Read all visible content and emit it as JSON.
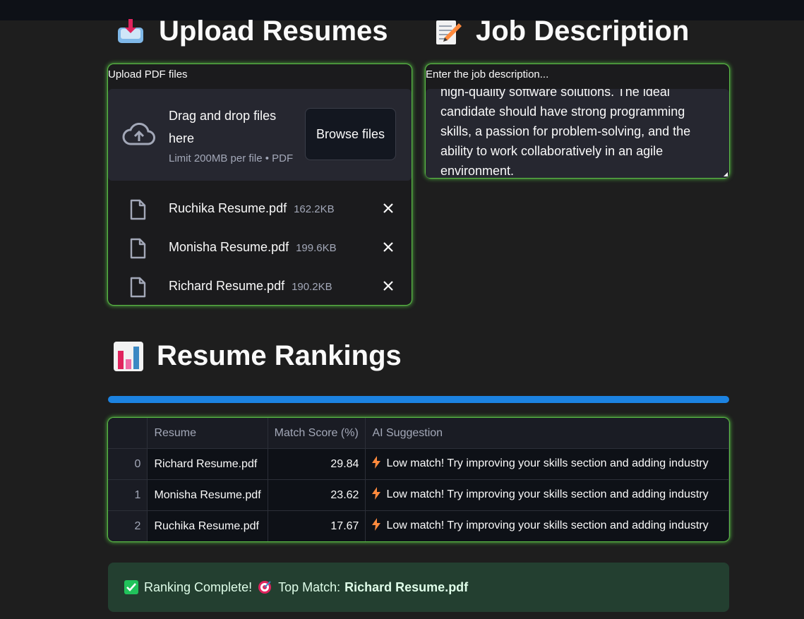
{
  "upload": {
    "heading": "Upload Resumes",
    "heading_icon": "inbox-tray-icon",
    "label": "Upload PDF files",
    "dropzone_title": "Drag and drop files here",
    "dropzone_limit": "Limit 200MB per file • PDF",
    "browse_label": "Browse files",
    "files": [
      {
        "name": "Ruchika Resume.pdf",
        "size": "162.2KB"
      },
      {
        "name": "Monisha Resume.pdf",
        "size": "199.6KB"
      },
      {
        "name": "Richard Resume.pdf",
        "size": "190.2KB"
      }
    ]
  },
  "job": {
    "heading": "Job Description",
    "heading_icon": "memo-icon",
    "label": "Enter the job description...",
    "text": "high-quality software solutions. The ideal candidate should have strong programming skills, a passion for problem-solving, and the ability to work collaboratively in an agile environment."
  },
  "rankings": {
    "heading": "Resume Rankings",
    "heading_icon": "bar-chart-icon",
    "progress": 1.0,
    "columns": [
      "",
      "Resume",
      "Match Score (%)",
      "AI Suggestion"
    ],
    "rows": [
      {
        "index": "0",
        "resume": "Richard Resume.pdf",
        "score": "29.84",
        "suggestion": "Low match! Try improving your skills section and adding industry"
      },
      {
        "index": "1",
        "resume": "Monisha Resume.pdf",
        "score": "23.62",
        "suggestion": "Low match! Try improving your skills section and adding industry"
      },
      {
        "index": "2",
        "resume": "Ruchika Resume.pdf",
        "score": "17.67",
        "suggestion": "Low match! Try improving your skills section and adding industry"
      }
    ]
  },
  "status": {
    "prefix": "Ranking Complete!",
    "top_label": "Top Match:",
    "top_value": "Richard Resume.pdf"
  },
  "colors": {
    "accent": "#1c83e1",
    "glow": "#5ad246",
    "success_bg": "#233f30",
    "bolt": "#ff8a3d"
  }
}
